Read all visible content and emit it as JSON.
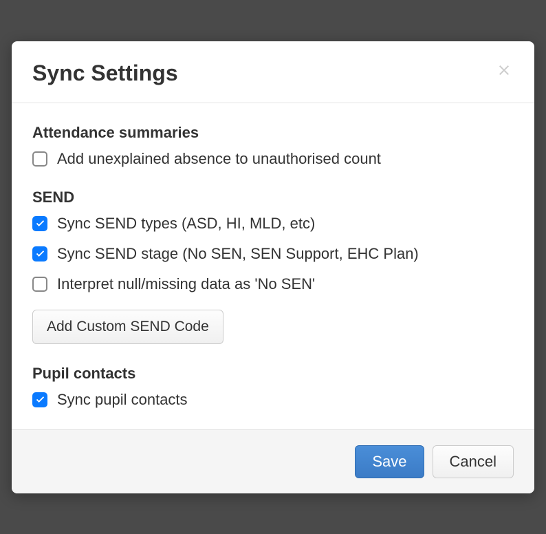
{
  "modal": {
    "title": "Sync Settings",
    "sections": {
      "attendance": {
        "title": "Attendance summaries",
        "options": {
          "unexplained_absence": {
            "label": "Add unexplained absence to unauthorised count",
            "checked": false
          }
        }
      },
      "send": {
        "title": "SEND",
        "options": {
          "sync_types": {
            "label": "Sync SEND types (ASD, HI, MLD, etc)",
            "checked": true
          },
          "sync_stage": {
            "label": "Sync SEND stage (No SEN, SEN Support, EHC Plan)",
            "checked": true
          },
          "interpret_null": {
            "label": "Interpret null/missing data as 'No SEN'",
            "checked": false
          }
        },
        "add_custom_button": "Add Custom SEND Code"
      },
      "pupil_contacts": {
        "title": "Pupil contacts",
        "options": {
          "sync_contacts": {
            "label": "Sync pupil contacts",
            "checked": true
          }
        }
      }
    },
    "footer": {
      "save_label": "Save",
      "cancel_label": "Cancel"
    }
  }
}
